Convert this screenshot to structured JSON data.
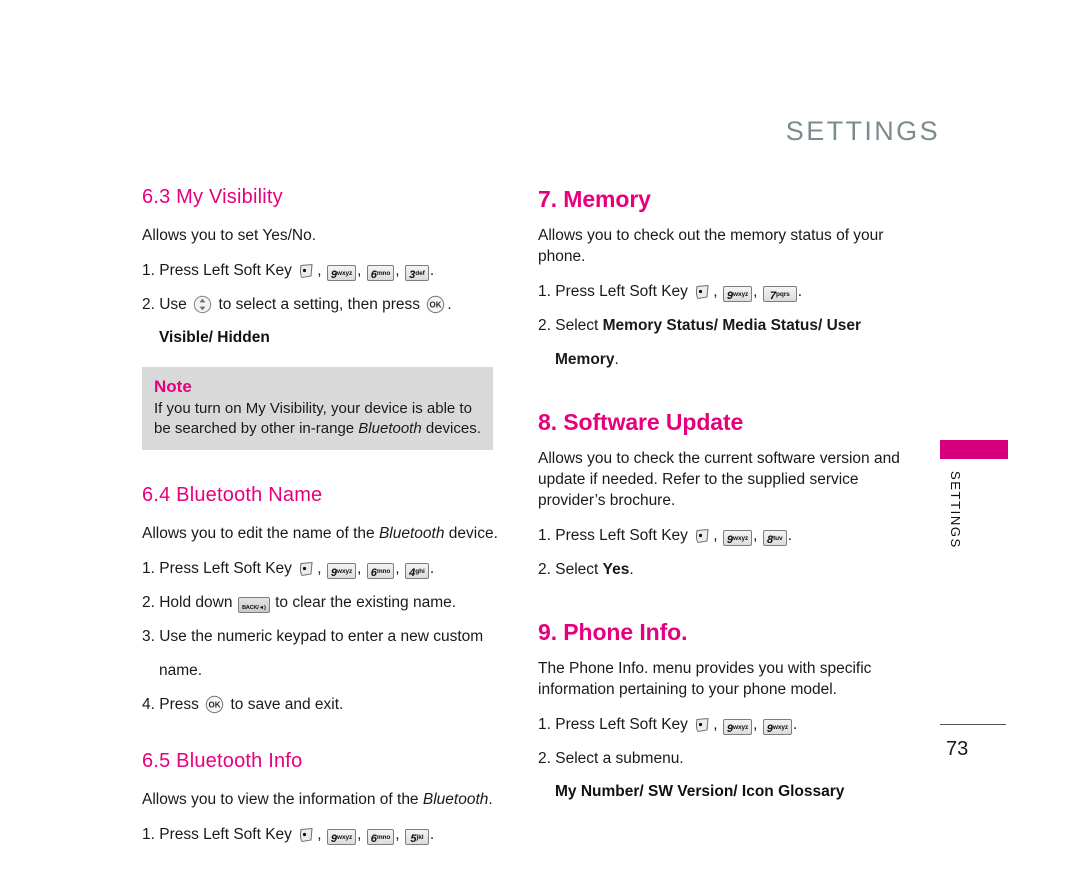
{
  "document": {
    "chapter_header": "SETTINGS",
    "page_number": "73",
    "side_tab_label": "SETTINGS",
    "accent_color": "#E6007E",
    "side_tab_color": "#D6007F",
    "header_color": "#7B8C8E",
    "note_bg_color": "#D9D9D9"
  },
  "left_column": {
    "section_63": {
      "heading": "6.3 My Visibility",
      "intro": "Allows you to set Yes/No.",
      "step1_prefix": "1. Press Left Soft Key",
      "step1_keys": [
        {
          "digit": "9",
          "letters": "wxyz"
        },
        {
          "digit": "6",
          "letters": "mno"
        },
        {
          "digit": "3",
          "letters": "def"
        }
      ],
      "step2_prefix": "2. Use",
      "step2_middle": "to select a setting, then press",
      "step2_suffix": ".",
      "options": "Visible/ Hidden"
    },
    "note": {
      "title": "Note",
      "line1": "If you turn on My Visibility, your device is able to",
      "line2_pre": "be searched by other in-range ",
      "line2_italic": "Bluetooth",
      "line2_post": " devices."
    },
    "section_64": {
      "heading": "6.4 Bluetooth Name",
      "intro_pre": "Allows you to edit the name of the ",
      "intro_italic": "Bluetooth",
      "intro_post": " device.",
      "step1_prefix": "1. Press Left Soft Key",
      "step1_keys": [
        {
          "digit": "9",
          "letters": "wxyz"
        },
        {
          "digit": "6",
          "letters": "mno"
        },
        {
          "digit": "4",
          "letters": "ghi"
        }
      ],
      "step2_prefix": "2. Hold down",
      "step2_key_label": "BACK/",
      "step2_suffix": "to clear the existing name.",
      "step3": "3. Use the numeric keypad to enter a new custom",
      "step3_cont": "name.",
      "step4_prefix": "4. Press",
      "step4_suffix": "to save and exit."
    },
    "section_65": {
      "heading": "6.5 Bluetooth Info",
      "intro_pre": "Allows you to view the information of the ",
      "intro_italic": "Bluetooth",
      "intro_post": ".",
      "step1_prefix": "1. Press Left Soft Key",
      "step1_keys": [
        {
          "digit": "9",
          "letters": "wxyz"
        },
        {
          "digit": "6",
          "letters": "mno"
        },
        {
          "digit": "5",
          "letters": "jkl"
        }
      ]
    }
  },
  "right_column": {
    "section_7": {
      "heading": "7. Memory",
      "intro_line1": "Allows you to check out the memory status of your",
      "intro_line2": "phone.",
      "step1_prefix": "1. Press Left Soft Key",
      "step1_keys": [
        {
          "digit": "9",
          "letters": "wxyz"
        },
        {
          "digit": "7",
          "letters": "pqrs"
        }
      ],
      "step2_prefix": "2. Select ",
      "step2_bold": "Memory Status/ Media Status/ User",
      "step2_bold_cont": "Memory",
      "step2_suffix": "."
    },
    "section_8": {
      "heading": "8. Software Update",
      "intro_line1": "Allows you to check the current software version and",
      "intro_line2": "update if needed. Refer to the supplied service",
      "intro_line3": "provider’s brochure.",
      "step1_prefix": "1. Press Left Soft Key",
      "step1_keys": [
        {
          "digit": "9",
          "letters": "wxyz"
        },
        {
          "digit": "8",
          "letters": "tuv"
        }
      ],
      "step2_prefix": "2. Select ",
      "step2_bold": "Yes",
      "step2_suffix": "."
    },
    "section_9": {
      "heading": "9. Phone Info.",
      "intro_line1": "The Phone Info. menu provides you with specific",
      "intro_line2": "information pertaining to your phone model.",
      "step1_prefix": "1. Press Left Soft Key",
      "step1_keys": [
        {
          "digit": "9",
          "letters": "wxyz"
        },
        {
          "digit": "9",
          "letters": "wxyz"
        }
      ],
      "step2": "2. Select a submenu.",
      "options": "My Number/ SW Version/ Icon Glossary"
    }
  },
  "icons": {
    "left_soft_key": "left-soft-key-icon",
    "nav_key": "navigation-updown-key-icon",
    "ok_key": "ok-key-icon",
    "back_key": "back-key-icon"
  }
}
